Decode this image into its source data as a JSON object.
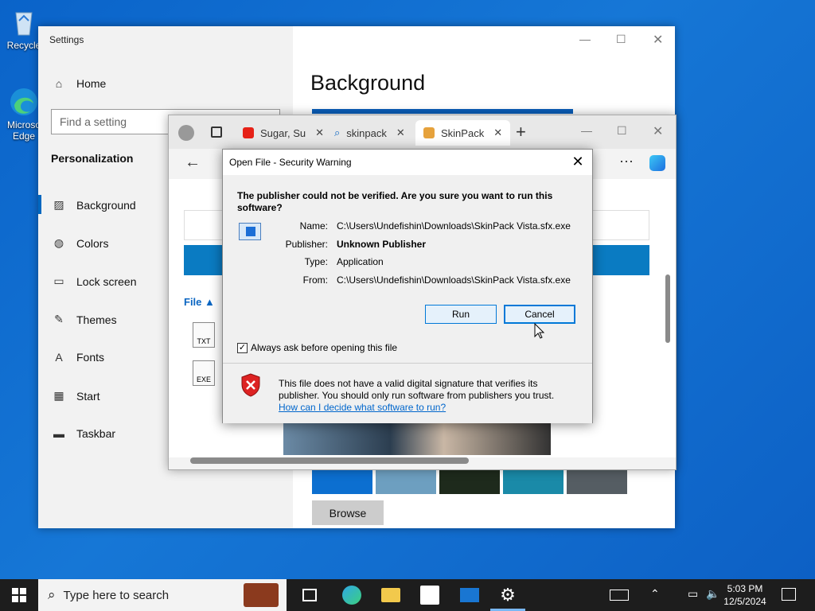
{
  "desktop": {
    "recycle_label": "Recycle",
    "edge_label1": "Microso",
    "edge_label2": "Edge"
  },
  "settings": {
    "title": "Settings",
    "home": "Home",
    "search_placeholder": "Find a setting",
    "section": "Personalization",
    "nav": [
      "Background",
      "Colors",
      "Lock screen",
      "Themes",
      "Fonts",
      "Start",
      "Taskbar"
    ],
    "nav_icons": [
      "image-icon",
      "palette-icon",
      "lock-screen-icon",
      "themes-icon",
      "fonts-icon",
      "start-icon",
      "taskbar-icon"
    ],
    "page_title": "Background",
    "browse": "Browse"
  },
  "edge": {
    "tabs": [
      "Sugar, Su",
      "skinpack",
      "SkinPack"
    ],
    "file_header": "File",
    "file_icons": [
      "TXT",
      "EXE"
    ]
  },
  "dialog": {
    "title": "Open File - Security Warning",
    "question": "The publisher could not be verified.  Are you sure you want to run this software?",
    "fields": {
      "name_label": "Name:",
      "name_value": "C:\\Users\\Undefishin\\Downloads\\SkinPack Vista.sfx.exe",
      "publisher_label": "Publisher:",
      "publisher_value": "Unknown Publisher",
      "type_label": "Type:",
      "type_value": "Application",
      "from_label": "From:",
      "from_value": "C:\\Users\\Undefishin\\Downloads\\SkinPack Vista.sfx.exe"
    },
    "run_button": "Run",
    "cancel_button": "Cancel",
    "checkbox_label": "Always ask before opening this file",
    "checkbox_checked": true,
    "warning_text": "This file does not have a valid digital signature that verifies its publisher.  You should only run software from publishers you trust.",
    "warning_link": "How can I decide what software to run?"
  },
  "taskbar": {
    "search_placeholder": "Type here to search",
    "time": "5:03 PM",
    "date": "12/5/2024"
  },
  "colors": {
    "accent": "#0078d7",
    "desktop": "#0a63c9",
    "link": "#0066cc"
  }
}
